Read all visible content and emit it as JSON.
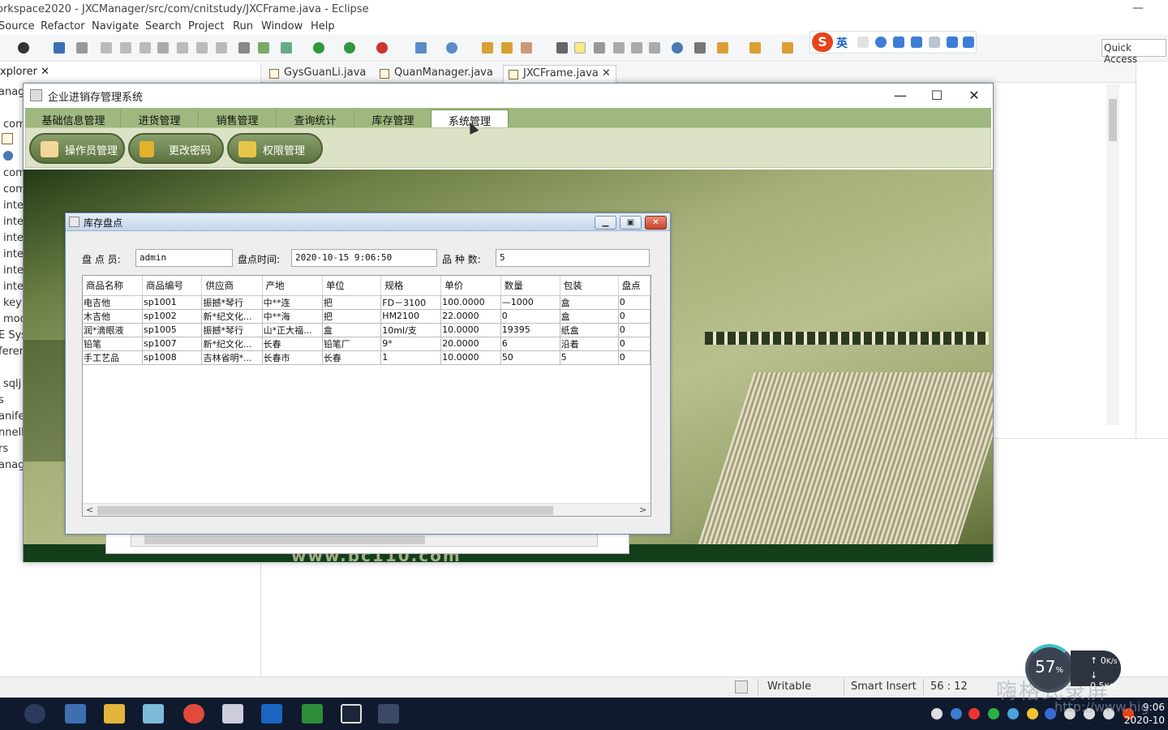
{
  "eclipse": {
    "title": "orkspace2020 - JXCManager/src/com/cnitstudy/JXCFrame.java - Eclipse",
    "menu": [
      "Source",
      "Refactor",
      "Navigate",
      "Search",
      "Project",
      "Run",
      "Window",
      "Help"
    ],
    "quick_access": "Quick Access",
    "ime_lang": "英",
    "explorer_tab": "xplorer",
    "tree_items": [
      "anag",
      "",
      "com",
      "",
      "com",
      "com",
      "inte",
      "inte",
      "inte",
      "inte",
      "inte",
      "inte",
      "key",
      "mod",
      "E Sys",
      "feren",
      "sqlj",
      "s",
      "anifes",
      "nnell",
      "rs",
      "anag"
    ],
    "editor_tabs": [
      "GysGuanLi.java",
      "QuanManager.java",
      "JXCFrame.java"
    ],
    "status": {
      "writable": "Writable",
      "insert_mode": "Smart Insert",
      "position": "56 : 12"
    }
  },
  "jxc": {
    "title": "企业进销存管理系统",
    "tabs": [
      "基础信息管理",
      "进货管理",
      "销售管理",
      "查询统计",
      "库存管理",
      "系统管理"
    ],
    "selected_tab": "系统管理",
    "toolbar_buttons": [
      "操作员管理",
      "更改密码",
      "权限管理"
    ],
    "banner_text": "www.bc110.com",
    "inventory": {
      "title": "库存盘点",
      "operator_label": "盘 点 员:",
      "operator_value": "admin",
      "time_label": "盘点时间:",
      "time_value": "2020-10-15 9:06:50",
      "kinds_label": "品 种 数:",
      "kinds_value": "5",
      "columns": [
        "商品名称",
        "商品编号",
        "供应商",
        "产地",
        "单位",
        "规格",
        "单价",
        "数量",
        "包装",
        "盘点"
      ],
      "rows": [
        [
          "电吉他",
          "sp1001",
          "振撼*琴行",
          "中**连",
          "把",
          "FD－3100",
          "100.0000",
          "—1000",
          "盒",
          "0"
        ],
        [
          "木吉他",
          "sp1002",
          "新*纪文化...",
          "中**海",
          "把",
          "HM2100",
          "22.0000",
          "0",
          "盒",
          "0"
        ],
        [
          "润*滴眼液",
          "sp1005",
          "振撼*琴行",
          "山*正大福...",
          "盒",
          "10ml/支",
          "10.0000",
          "19395",
          "纸盒",
          "0"
        ],
        [
          "铅笔",
          "sp1007",
          "新*纪文化...",
          "长春",
          "铅笔厂",
          "9*",
          "20.0000",
          "6",
          "沿着",
          "0"
        ],
        [
          "手工艺品",
          "sp1008",
          "吉林省明*...",
          "长春市",
          "长春",
          "1",
          "10.0000",
          "50",
          "5",
          "0"
        ]
      ]
    }
  },
  "tray": {
    "net_percent": "57",
    "up_rate": "0",
    "down_rate": "0.5",
    "rate_unit": "K/s",
    "clock_time": "9:06",
    "clock_date": "2020-10",
    "watermark": "嗨格式录屏",
    "watermark_url": "http://www.hig"
  }
}
